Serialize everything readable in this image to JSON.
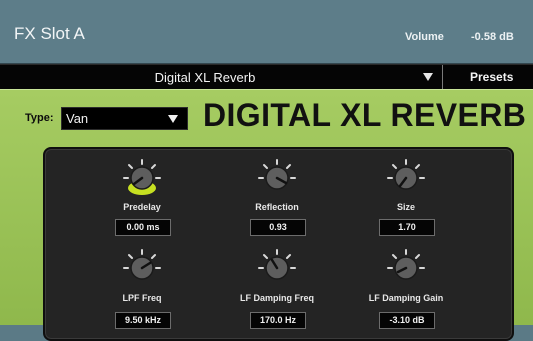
{
  "header": {
    "title": "FX Slot A",
    "volume_label": "Volume",
    "volume_value": "-0.58 dB"
  },
  "preset_bar": {
    "preset_name": "Digital XL Reverb",
    "presets_button": "Presets"
  },
  "main": {
    "type_label": "Type:",
    "type_value": "Van",
    "title": "DIGITAL XL REVERB"
  },
  "controls": [
    {
      "label": "Predelay",
      "value": "0.00 ms",
      "highlighted": true
    },
    {
      "label": "Reflection",
      "value": "0.93",
      "highlighted": false
    },
    {
      "label": "Size",
      "value": "1.70",
      "highlighted": false
    },
    {
      "label": "LPF Freq",
      "value": "9.50 kHz",
      "highlighted": false
    },
    {
      "label": "LF Damping Freq",
      "value": "170.0 Hz",
      "highlighted": false
    },
    {
      "label": "LF Damping Gain",
      "value": "-3.10 dB",
      "highlighted": false
    }
  ],
  "colors": {
    "header_bg": "#5d7d89",
    "panel_green": "#a6cc62",
    "highlight": "#c6e021"
  }
}
